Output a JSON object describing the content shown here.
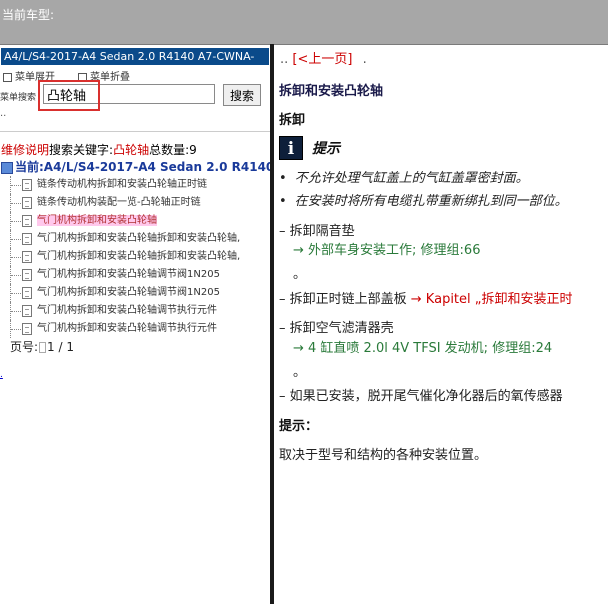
{
  "header": {
    "label": "当前车型:"
  },
  "left": {
    "model": "A4/L/S4-2017-A4 Sedan 2.0 R4140 A7-CWNA-",
    "menu_expand": "菜单展开",
    "menu_collapse": "菜单折叠",
    "search_label": "菜单搜索",
    "search_value": "凸轮轴",
    "search_button": "搜索",
    "dots": "..",
    "summary_prefix": "维修说明",
    "summary_text": "搜索关键字:",
    "summary_keyword": "凸轮轴",
    "summary_count_label": "总数量:",
    "summary_count": "9",
    "current": "当前:A4/L/S4-2017-A4 Sedan 2.0 R4140",
    "tree_items": [
      "链条传动机构拆卸和安装凸轮轴正时链",
      "链条传动机构装配一览-凸轮轴正时链",
      "气门机构拆卸和安装凸轮轴",
      "气门机构拆卸和安装凸轮轴拆卸和安装凸轮轴,",
      "气门机构拆卸和安装凸轮轴拆卸和安装凸轮轴,",
      "气门机构拆卸和安装凸轮轴调节阀1N205",
      "气门机构拆卸和安装凸轮轴调节阀1N205",
      "气门机构拆卸和安装凸轮轴调节执行元件",
      "气门机构拆卸和安装凸轮轴调节执行元件"
    ],
    "pager_label": "页号:",
    "pager_value": "1 / 1",
    "bottom_link": "."
  },
  "right": {
    "prev_prefix": "..",
    "prev_link": "[<上一页]",
    "prev_suffix": ".",
    "title": "拆卸和安装凸轮轴",
    "section": "拆卸",
    "tip_icon": "i",
    "tip_title": "提示",
    "bullet1": "不允许处理气缸盖上的气缸盖罩密封面。",
    "bullet2": "在安装时将所有电缆扎带重新绑扎到同一部位。",
    "step1": "– 拆卸隔音垫",
    "step1_ref": "→ 外部车身安装工作; 修理组:66",
    "step1_end": "。",
    "step2_prefix": "– 拆卸正时链上部盖板",
    "step2_ref": "→ Kapitel „拆卸和安装正时",
    "step3": "– 拆卸空气滤清器壳",
    "step3_ref": "→ 4 缸直喷 2.0l 4V TFSI 发动机; 修理组:24",
    "step3_end": "。",
    "step4": "– 如果已安装，脱开尾气催化净化器后的氧传感器",
    "note_label": "提示：",
    "note_text": "取决于型号和结构的各种安装位置。"
  }
}
